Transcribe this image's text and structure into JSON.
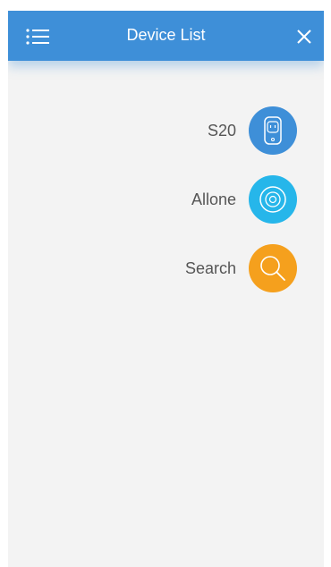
{
  "header": {
    "title": "Device List",
    "menu_icon": "list-menu-icon",
    "close_icon": "close-icon",
    "color": "#3e8fd8"
  },
  "items": [
    {
      "label": "S20",
      "icon": "smart-plug-icon",
      "color": "#3e8fd8"
    },
    {
      "label": "Allone",
      "icon": "allone-remote-icon",
      "color": "#26b6ea"
    },
    {
      "label": "Search",
      "icon": "search-icon",
      "color": "#f5a01d"
    }
  ]
}
